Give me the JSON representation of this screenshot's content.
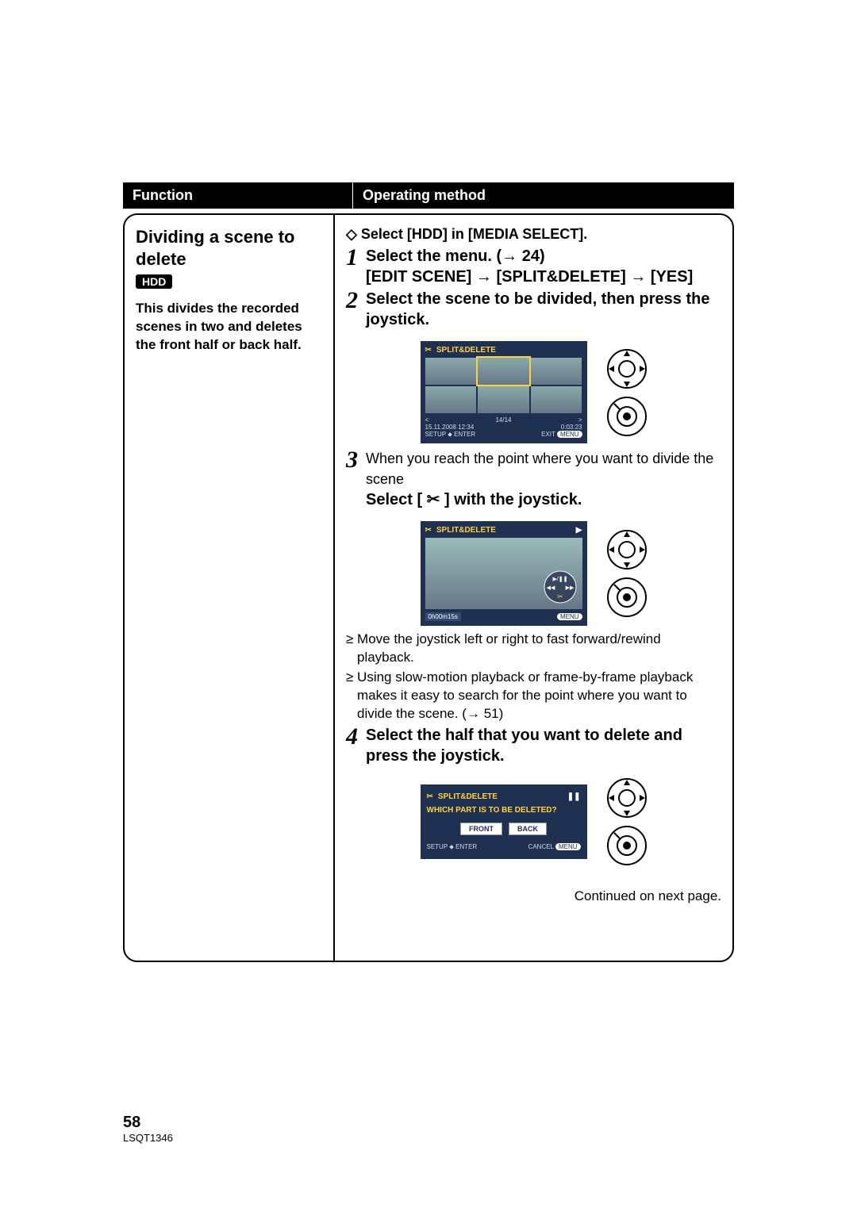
{
  "header": {
    "function": "Function",
    "operating": "Operating method"
  },
  "left": {
    "title": "Dividing a scene to delete",
    "badge": "HDD",
    "desc": "This divides the recorded scenes in two and deletes the front half or back half."
  },
  "right": {
    "diamond": "◇ Select [HDD] in [MEDIA SELECT].",
    "step1": {
      "num": "1",
      "line1": "Select the menu. (→ 24)",
      "line2": "[EDIT SCENE] → [SPLIT&DELETE] → [YES]"
    },
    "step2": {
      "num": "2",
      "text": "Select the scene to be divided, then press the joystick."
    },
    "screen1": {
      "icon": "✂",
      "title": "SPLIT&DELETE",
      "pager": "14/14",
      "date": "15.11.2008  12:34",
      "dur": "0:03:23",
      "setup": "SETUP ⬥ ENTER",
      "exit": "EXIT",
      "menu": "MENU"
    },
    "step3": {
      "num": "3",
      "lead": "When you reach the point where you want to divide the scene",
      "bold": "Select [ ✂ ] with the joystick."
    },
    "screen2": {
      "icon": "✂",
      "title": "SPLIT&DELETE",
      "play": "▶",
      "time": "0h00m15s",
      "menu": "MENU"
    },
    "bullets": [
      "≥ Move the joystick left or right to fast forward/rewind playback.",
      "≥ Using slow-motion playback or frame-by-frame playback makes it easy to search for the point where you want to divide the scene. (→ 51)"
    ],
    "step4": {
      "num": "4",
      "text": "Select the half that you want to delete and press the joystick."
    },
    "screen3": {
      "icon": "✂",
      "title": "SPLIT&DELETE",
      "pause": "❚❚",
      "question": "WHICH PART IS TO BE DELETED?",
      "front": "FRONT",
      "back": "BACK",
      "setup": "SETUP ⬥ ENTER",
      "cancel": "CANCEL",
      "menu": "MENU"
    },
    "continued": "Continued on next page."
  },
  "footer": {
    "page": "58",
    "code": "LSQT1346"
  }
}
